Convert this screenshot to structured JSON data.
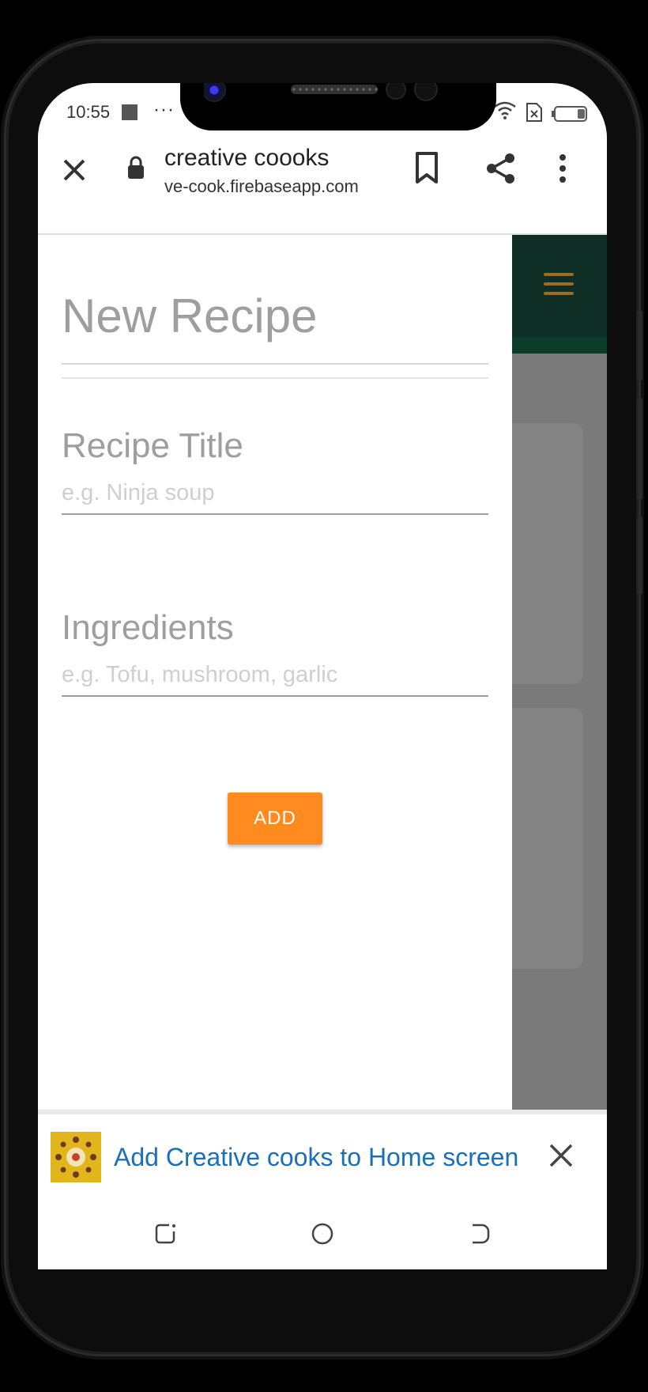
{
  "status_bar": {
    "time": "10:55",
    "dots": "···"
  },
  "browser": {
    "page_title": "creative coooks",
    "url": "ve-cook.firebaseapp.com",
    "icons": [
      "close-icon",
      "lock-icon",
      "bookmark-icon",
      "share-icon",
      "more-vert-icon"
    ]
  },
  "drawer": {
    "title": "New Recipe",
    "fields": [
      {
        "label": "Recipe Title",
        "placeholder": "e.g. Ninja soup",
        "value": ""
      },
      {
        "label": "Ingredients",
        "placeholder": "e.g. Tofu, mushroom, garlic",
        "value": ""
      }
    ],
    "add_label": "ADD"
  },
  "banner": {
    "text": "Add Creative cooks to Home screen"
  },
  "colors": {
    "nav_dark_green": "#0f2e25",
    "accent_orange": "#ff8a1f",
    "banner_link_blue": "#1a6fbd",
    "label_gray": "#9e9e9e"
  }
}
